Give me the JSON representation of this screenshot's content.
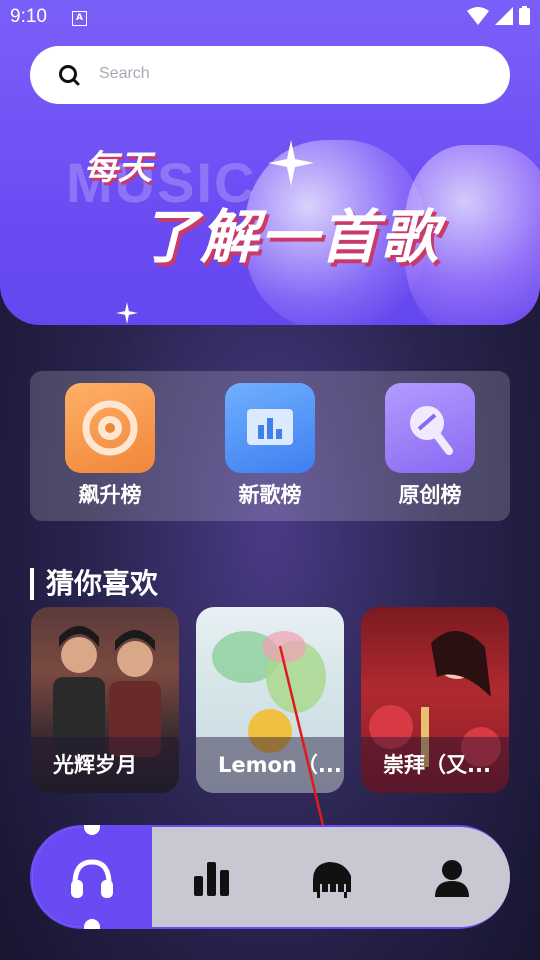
{
  "status_bar": {
    "time": "9:10",
    "notification_icon": "a-icon"
  },
  "banner": {
    "background_word": "MUSIC",
    "line1": "每天",
    "line2": "了解一首歌"
  },
  "search": {
    "placeholder": "Search"
  },
  "charts": [
    {
      "label": "飙升榜",
      "icon": "disc-icon",
      "color": "#f7963f"
    },
    {
      "label": "新歌榜",
      "icon": "bar-chart-icon",
      "color": "#4b8df6"
    },
    {
      "label": "原创榜",
      "icon": "mic-icon",
      "color": "#9a7cf6"
    }
  ],
  "recommend": {
    "title": "猜你喜欢",
    "albums": [
      {
        "title": "光辉岁月"
      },
      {
        "title": "Lemon（..."
      },
      {
        "title": "崇拜（又..."
      }
    ]
  },
  "nav": {
    "items": [
      "headphones-icon",
      "bar-chart-icon",
      "piano-icon",
      "user-icon"
    ],
    "active_index": 0,
    "accent": "#6a4bf3"
  }
}
